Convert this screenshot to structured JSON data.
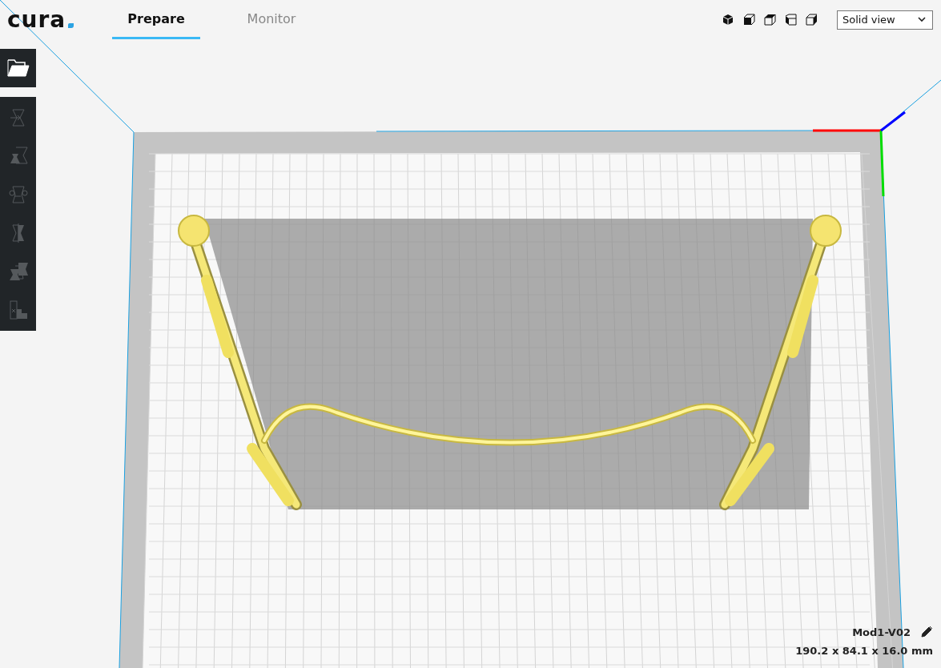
{
  "header": {
    "logo": "cura",
    "tabs": [
      {
        "label": "Prepare",
        "selected": true
      },
      {
        "label": "Monitor",
        "selected": false
      }
    ],
    "view_buttons": [
      {
        "kind": "perspective"
      },
      {
        "kind": "front"
      },
      {
        "kind": "top"
      },
      {
        "kind": "left"
      },
      {
        "kind": "right"
      }
    ],
    "view_mode": {
      "value": "Solid view"
    }
  },
  "toolbar": {
    "open_button": {
      "kind": "open"
    },
    "tools": [
      {
        "kind": "move",
        "disabled": true
      },
      {
        "kind": "scale",
        "disabled": true
      },
      {
        "kind": "rotate",
        "disabled": true
      },
      {
        "kind": "mirror",
        "disabled": true
      },
      {
        "kind": "per-model",
        "disabled": true
      },
      {
        "kind": "support",
        "disabled": true
      }
    ]
  },
  "object_info": {
    "name": "Mod1-V02",
    "dimensions": "190.2 x 84.1 x 16.0 mm"
  }
}
